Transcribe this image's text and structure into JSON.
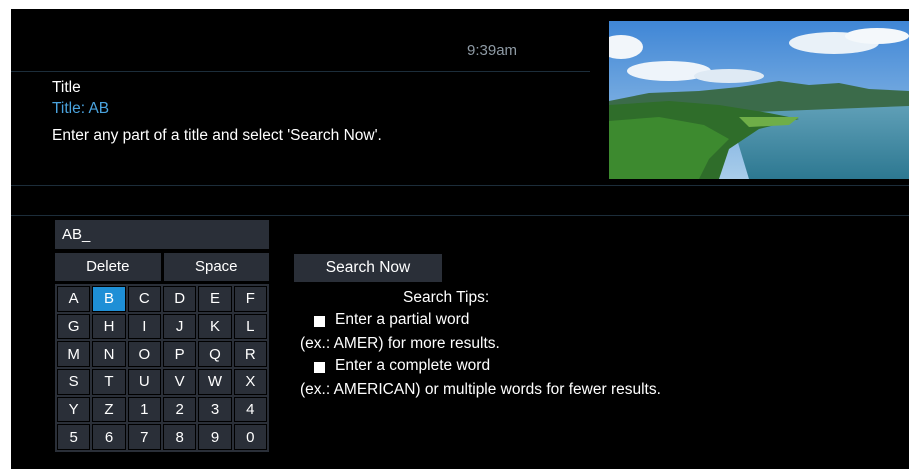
{
  "header": {
    "time": "9:39am",
    "title_label": "Title",
    "title_value": "Title: AB",
    "instruction": "Enter any part of a title and select 'Search Now'."
  },
  "preview": {
    "description_icon": "landscape-thumbnail"
  },
  "keyboard": {
    "input_value": "AB_",
    "delete_label": "Delete",
    "space_label": "Space",
    "selected_key": "B",
    "keys": [
      "A",
      "B",
      "C",
      "D",
      "E",
      "F",
      "G",
      "H",
      "I",
      "J",
      "K",
      "L",
      "M",
      "N",
      "O",
      "P",
      "Q",
      "R",
      "S",
      "T",
      "U",
      "V",
      "W",
      "X",
      "Y",
      "Z",
      "1",
      "2",
      "3",
      "4",
      "5",
      "6",
      "7",
      "8",
      "9",
      "0"
    ]
  },
  "actions": {
    "search_now_label": "Search Now"
  },
  "tips": {
    "heading": "Search Tips:",
    "tip1_title": "Enter a partial word",
    "tip1_detail": "(ex.: AMER) for more results.",
    "tip2_title": "Enter a complete word",
    "tip2_detail": "(ex.: AMERICAN) or multiple words for fewer results."
  },
  "colors": {
    "background": "#000000",
    "accent": "#1e8fd6",
    "title_value": "#4aa3de",
    "key_bg": "#2a2f38"
  }
}
